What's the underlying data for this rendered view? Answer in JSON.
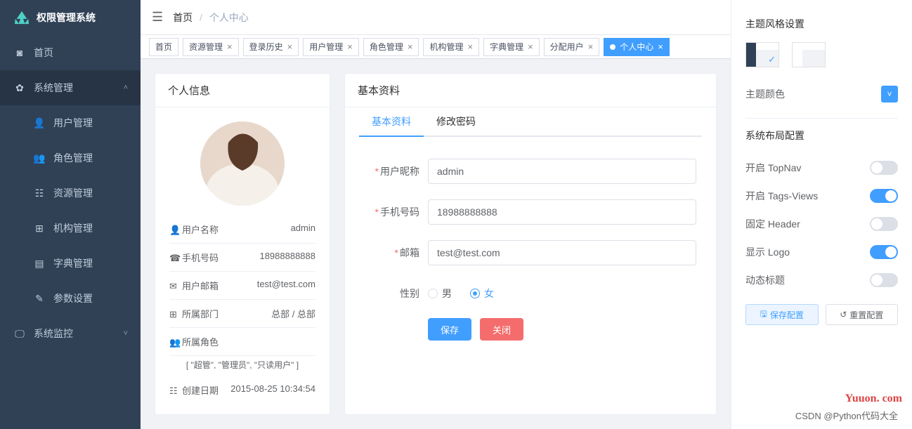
{
  "app": {
    "title": "权限管理系统"
  },
  "breadcrumb": {
    "home": "首页",
    "current": "个人中心"
  },
  "sidebar": {
    "items": [
      {
        "label": "首页"
      },
      {
        "label": "系统管理"
      },
      {
        "label": "用户管理"
      },
      {
        "label": "角色管理"
      },
      {
        "label": "资源管理"
      },
      {
        "label": "机构管理"
      },
      {
        "label": "字典管理"
      },
      {
        "label": "参数设置"
      },
      {
        "label": "系统监控"
      }
    ]
  },
  "tags": [
    {
      "label": "首页",
      "closable": false
    },
    {
      "label": "资源管理",
      "closable": true
    },
    {
      "label": "登录历史",
      "closable": true
    },
    {
      "label": "用户管理",
      "closable": true
    },
    {
      "label": "角色管理",
      "closable": true
    },
    {
      "label": "机构管理",
      "closable": true
    },
    {
      "label": "字典管理",
      "closable": true
    },
    {
      "label": "分配用户",
      "closable": true
    },
    {
      "label": "个人中心",
      "closable": true,
      "active": true
    }
  ],
  "profile_card": {
    "title": "个人信息"
  },
  "profile": [
    {
      "label": "用户名称",
      "value": "admin"
    },
    {
      "label": "手机号码",
      "value": "18988888888"
    },
    {
      "label": "用户邮箱",
      "value": "test@test.com"
    },
    {
      "label": "所属部门",
      "value": "总部 / 总部"
    }
  ],
  "profile_roles": {
    "label": "所属角色",
    "value": "[ \"超管\", \"管理员\", \"只读用户\" ]"
  },
  "profile_created": {
    "label": "创建日期",
    "value": "2015-08-25 10:34:54"
  },
  "basic_card": {
    "title": "基本资料"
  },
  "tabs": {
    "basic": "基本资料",
    "pwd": "修改密码"
  },
  "form": {
    "nickname": {
      "label": "用户昵称",
      "value": "admin"
    },
    "phone": {
      "label": "手机号码",
      "value": "18988888888"
    },
    "email": {
      "label": "邮箱",
      "value": "test@test.com"
    },
    "gender": {
      "label": "性别",
      "male": "男",
      "female": "女",
      "selected": "female"
    },
    "save": "保存",
    "close": "关闭"
  },
  "settings": {
    "title_theme_style": "主题风格设置",
    "title_theme_color": "主题颜色",
    "title_layout": "系统布局配置",
    "topnav": "开启 TopNav",
    "tagsviews": "开启 Tags-Views",
    "fixedheader": "固定 Header",
    "showlogo": "显示 Logo",
    "dyntitle": "动态标题",
    "save": "保存配置",
    "reset": "重置配置"
  },
  "watermark": "Yuuon. com",
  "footer": "CSDN @Python代码大全"
}
